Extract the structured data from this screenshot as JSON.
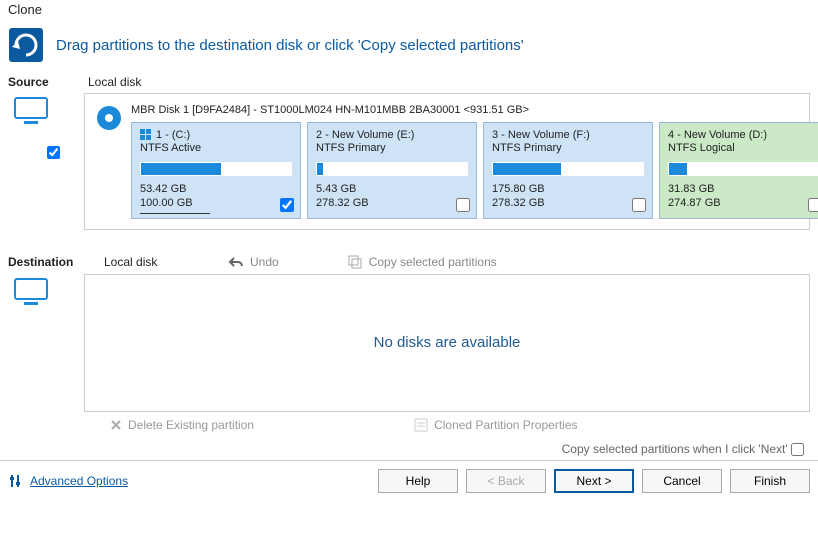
{
  "title": "Clone",
  "header": {
    "text": "Drag partitions to the destination disk or click 'Copy selected partitions'"
  },
  "source": {
    "label": "Source",
    "location": "Local disk",
    "disk_title": "MBR Disk 1 [D9FA2484] - ST1000LM024 HN-M101MBB 2BA30001  <931.51 GB>",
    "partitions": [
      {
        "name": "1 -  (C:)",
        "sub": "NTFS Active",
        "used": "53.42 GB",
        "total": "100.00 GB",
        "pct": 53,
        "style": "blue",
        "checked": true,
        "win": true
      },
      {
        "name": "2 - New Volume (E:)",
        "sub": "NTFS Primary",
        "used": "5.43 GB",
        "total": "278.32 GB",
        "pct": 4,
        "style": "blue",
        "checked": false,
        "win": false
      },
      {
        "name": "3 - New Volume (F:)",
        "sub": "NTFS Primary",
        "used": "175.80 GB",
        "total": "278.32 GB",
        "pct": 45,
        "style": "blue",
        "checked": false,
        "win": false
      },
      {
        "name": "4 - New Volume (D:)",
        "sub": "NTFS Logical",
        "used": "31.83 GB",
        "total": "274.87 GB",
        "pct": 12,
        "style": "green",
        "checked": false,
        "win": false
      }
    ]
  },
  "destination": {
    "label": "Destination",
    "location": "Local disk",
    "undo": "Undo",
    "copy_sel": "Copy selected partitions",
    "empty": "No disks are available",
    "delete_existing": "Delete Existing partition",
    "cloned_props": "Cloned Partition Properties",
    "copy_next_hint": "Copy selected partitions when I click 'Next'"
  },
  "footer": {
    "advanced": "Advanced Options",
    "help": "Help",
    "back": "< Back",
    "next": "Next >",
    "cancel": "Cancel",
    "finish": "Finish"
  }
}
